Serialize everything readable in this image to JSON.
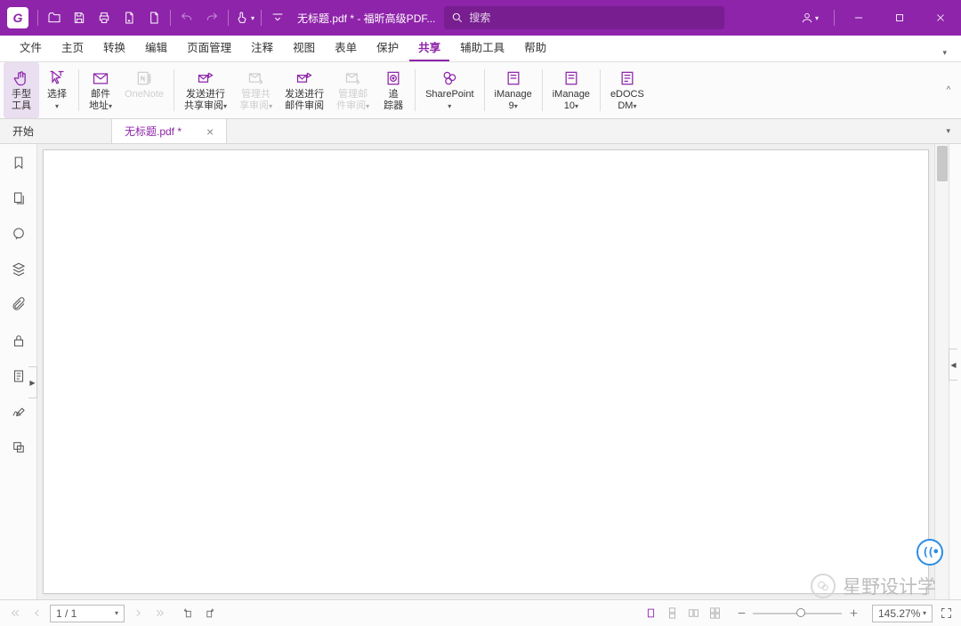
{
  "titlebar": {
    "app_logo": "G",
    "doc_title": "无标题.pdf * - 福昕高级PDF...",
    "search_placeholder": "搜索"
  },
  "menutabs": [
    {
      "label": "文件"
    },
    {
      "label": "主页"
    },
    {
      "label": "转换"
    },
    {
      "label": "编辑"
    },
    {
      "label": "页面管理"
    },
    {
      "label": "注释"
    },
    {
      "label": "视图"
    },
    {
      "label": "表单"
    },
    {
      "label": "保护"
    },
    {
      "label": "共享",
      "active": true
    },
    {
      "label": "辅助工具"
    },
    {
      "label": "帮助"
    }
  ],
  "ribbon": {
    "hand": {
      "l1": "手型",
      "l2": "工具",
      "active": true,
      "dd": false
    },
    "select": {
      "l1": "选择",
      "l2": "",
      "dd": true
    },
    "email": {
      "l1": "邮件",
      "l2": "地址",
      "dd": true
    },
    "onenote": {
      "l1": "OneNote",
      "l2": "",
      "disabled": true
    },
    "send_share": {
      "l1": "发送进行",
      "l2": "共享审阅",
      "dd": true
    },
    "manage_share": {
      "l1": "管理共",
      "l2": "享审阅",
      "dd": true,
      "disabled": true
    },
    "send_mail": {
      "l1": "发送进行",
      "l2": "邮件审阅"
    },
    "manage_mail": {
      "l1": "管理邮",
      "l2": "件审阅",
      "dd": true,
      "disabled": true
    },
    "tracker": {
      "l1": "追",
      "l2": "踪器"
    },
    "sharepoint": {
      "l1": "SharePoint",
      "l2": "",
      "dd": true
    },
    "imanage9": {
      "l1": "iManage",
      "l2": "9",
      "dd": true
    },
    "imanage10": {
      "l1": "iManage",
      "l2": "10",
      "dd": true
    },
    "edocs": {
      "l1": "eDOCS",
      "l2": "DM",
      "dd": true
    }
  },
  "doctabs": {
    "home": "开始",
    "active": "无标题.pdf *"
  },
  "statusbar": {
    "page": "1 / 1",
    "zoom": "145.27%"
  },
  "watermark": "星野设计学"
}
